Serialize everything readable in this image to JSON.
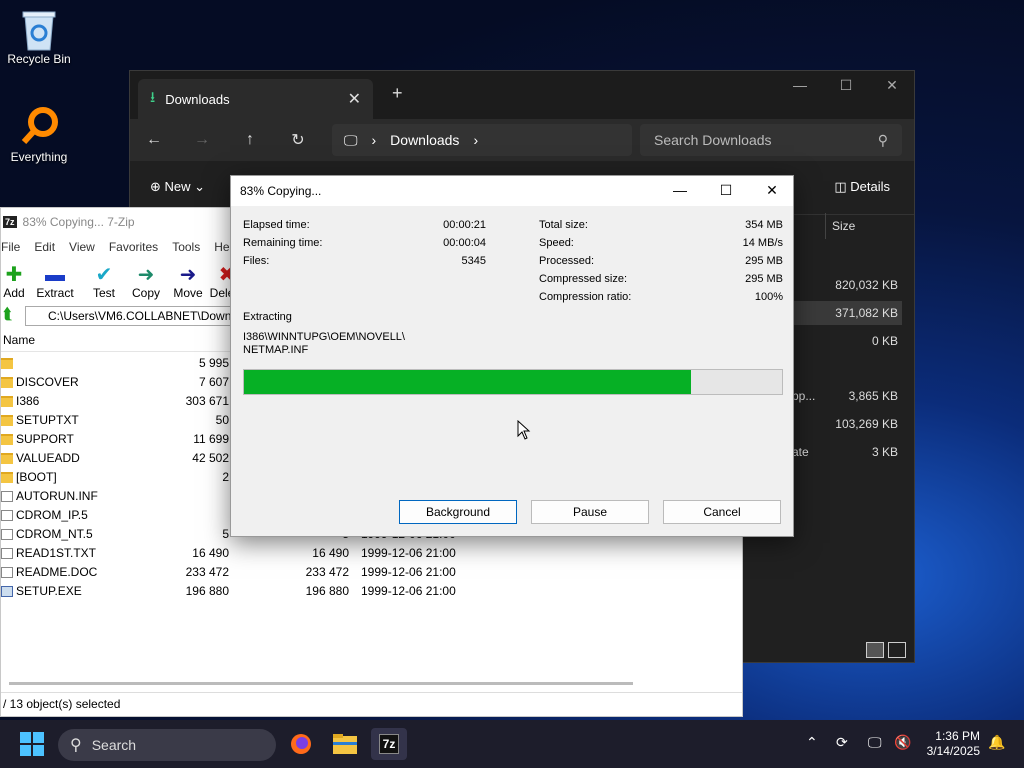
{
  "desktop": {
    "icons": [
      {
        "label": "Recycle Bin",
        "icon": "recycle-bin-icon"
      },
      {
        "label": "Everything",
        "icon": "everything-search-icon"
      }
    ]
  },
  "explorer": {
    "tab_label": "Downloads",
    "address_crumb": "Downloads",
    "search_placeholder": "Search Downloads",
    "new_label": "New",
    "details_label": "Details",
    "column_size": "Size",
    "sizes": [
      "820,032 KB",
      "371,082 KB",
      "0 KB",
      "3,865 KB",
      "103,269 KB",
      "3 KB"
    ],
    "type_fragments": [
      "pp...",
      "ate"
    ]
  },
  "zip": {
    "title": "83% Copying... 7-Zip",
    "app_badge": "7z",
    "menu": [
      "File",
      "Edit",
      "View",
      "Favorites",
      "Tools",
      "Help"
    ],
    "tools": [
      "Add",
      "Extract",
      "Test",
      "Copy",
      "Move",
      "Delete"
    ],
    "path": "C:\\Users\\VM6.COLLABNET\\Downl",
    "header_name": "Name",
    "header_size": "S",
    "rows": [
      {
        "name": "",
        "type": "folder",
        "size": "5 995",
        "packed": "",
        "date": ""
      },
      {
        "name": "DISCOVER",
        "type": "folder",
        "size": "7 607",
        "packed": "",
        "date": ""
      },
      {
        "name": "I386",
        "type": "folder",
        "size": "303 671",
        "packed": "",
        "date": ""
      },
      {
        "name": "SETUPTXT",
        "type": "folder",
        "size": "50",
        "packed": "",
        "date": ""
      },
      {
        "name": "SUPPORT",
        "type": "folder",
        "size": "11 699",
        "packed": "",
        "date": ""
      },
      {
        "name": "VALUEADD",
        "type": "folder",
        "size": "42 502",
        "packed": "",
        "date": ""
      },
      {
        "name": "[BOOT]",
        "type": "folder",
        "size": "2",
        "packed": "",
        "date": ""
      },
      {
        "name": "AUTORUN.INF",
        "type": "file",
        "size": "",
        "packed": "",
        "date": ""
      },
      {
        "name": "CDROM_IP.5",
        "type": "file",
        "size": "",
        "packed": "",
        "date": ""
      },
      {
        "name": "CDROM_NT.5",
        "type": "file",
        "size": "5",
        "packed": "5",
        "date": "1999-12-06 21:00"
      },
      {
        "name": "READ1ST.TXT",
        "type": "file",
        "size": "16 490",
        "packed": "16 490",
        "date": "1999-12-06 21:00"
      },
      {
        "name": "README.DOC",
        "type": "file",
        "size": "233 472",
        "packed": "233 472",
        "date": "1999-12-06 21:00"
      },
      {
        "name": "SETUP.EXE",
        "type": "exe",
        "size": "196 880",
        "packed": "196 880",
        "date": "1999-12-06 21:00"
      }
    ],
    "status": "/ 13 object(s) selected"
  },
  "dialog": {
    "title": "83% Copying...",
    "left_stats": [
      {
        "label": "Elapsed time:",
        "value": "00:00:21"
      },
      {
        "label": "Remaining time:",
        "value": "00:00:04"
      },
      {
        "label": "Files:",
        "value": "5345"
      }
    ],
    "right_stats": [
      {
        "label": "Total size:",
        "value": "354 MB"
      },
      {
        "label": "Speed:",
        "value": "14 MB/s"
      },
      {
        "label": "Processed:",
        "value": "295 MB"
      },
      {
        "label": "Compressed size:",
        "value": "295 MB"
      },
      {
        "label": "Compression ratio:",
        "value": "100%"
      }
    ],
    "operation": "Extracting",
    "current_path_line1": "I386\\WINNTUPG\\OEM\\NOVELL\\",
    "current_path_line2": "NETMAP.INF",
    "progress_fraction": 0.83,
    "progress_color": "#06b025",
    "buttons": {
      "background": "Background",
      "pause": "Pause",
      "cancel": "Cancel"
    }
  },
  "taskbar": {
    "search_label": "Search",
    "time": "1:36 PM",
    "date": "3/14/2025",
    "apps": [
      "firefox-icon",
      "file-explorer-icon",
      "7zip-icon"
    ]
  }
}
